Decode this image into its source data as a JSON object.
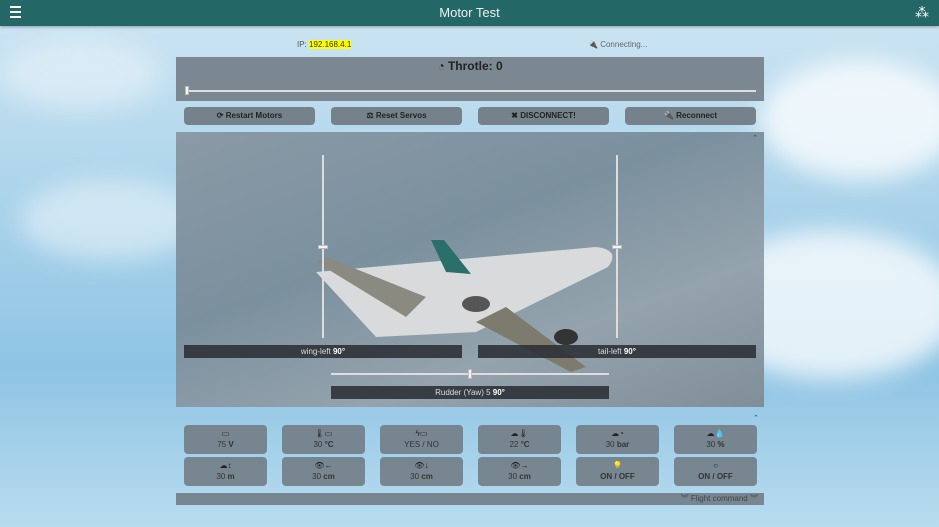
{
  "header": {
    "title": "Motor Test",
    "menu_icon": "hamburger-icon",
    "logo_icon": "cubes-icon"
  },
  "status": {
    "ip_label": "IP:",
    "ip": "192.168.4.1",
    "connection": "Connecting..."
  },
  "throttle": {
    "label": "Throtle: 0",
    "value": 0
  },
  "buttons": {
    "restart": "Restart Motors",
    "reset": "Reset Servos",
    "disconnect": "DISCONNECT!",
    "reconnect": "Reconnect"
  },
  "servos": {
    "wing_left": {
      "name": "wing-left",
      "value": "90°",
      "fraction": 0.5
    },
    "tail_left": {
      "name": "tail-left",
      "value": "90°",
      "fraction": 0.5
    },
    "rudder": {
      "name": "Rudder (Yaw) 5",
      "value": "90°",
      "fraction": 0.5
    }
  },
  "sensors": [
    {
      "icon": "battery-icon",
      "glyph": "▭",
      "value": "75",
      "unit": "V"
    },
    {
      "icon": "battery-temp-icon",
      "glyph": "🌡▭",
      "value": "30",
      "unit": "°C"
    },
    {
      "icon": "charging-icon",
      "glyph": "ϟ▭",
      "value": "YES / NO",
      "unit": ""
    },
    {
      "icon": "cloud-temp-icon",
      "glyph": "☁🌡",
      "value": "22",
      "unit": "°C"
    },
    {
      "icon": "cloud-pressure-icon",
      "glyph": "☁◔",
      "value": "30",
      "unit": "bar"
    },
    {
      "icon": "cloud-humidity-icon",
      "glyph": "☁💧",
      "value": "30",
      "unit": "%"
    },
    {
      "icon": "altitude-icon",
      "glyph": "☁↕",
      "value": "30",
      "unit": "m"
    },
    {
      "icon": "distance-left-icon",
      "glyph": "👁←",
      "value": "30",
      "unit": "cm"
    },
    {
      "icon": "distance-down-icon",
      "glyph": "👁↓",
      "value": "30",
      "unit": "cm"
    },
    {
      "icon": "distance-right-icon",
      "glyph": "👁→",
      "value": "30",
      "unit": "cm"
    },
    {
      "icon": "lightbulb-icon",
      "glyph": "💡",
      "value": "",
      "unit": "ON / OFF"
    },
    {
      "icon": "circle-icon",
      "glyph": "○",
      "value": "",
      "unit": "ON / OFF"
    }
  ],
  "footer": {
    "flight_command": "Flight command"
  }
}
